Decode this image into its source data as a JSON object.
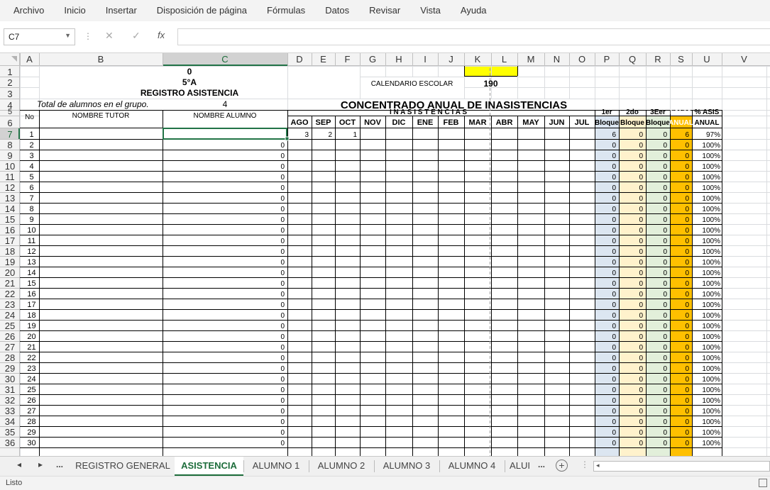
{
  "menu": [
    "Archivo",
    "Inicio",
    "Insertar",
    "Disposición de página",
    "Fórmulas",
    "Datos",
    "Revisar",
    "Vista",
    "Ayuda"
  ],
  "formula_bar": {
    "name_box": "C7",
    "cancel_icon": "✕",
    "enter_icon": "✓",
    "fx_label": "fx",
    "formula": ""
  },
  "columns": [
    "A",
    "B",
    "C",
    "D",
    "E",
    "F",
    "G",
    "H",
    "I",
    "J",
    "K",
    "L",
    "M",
    "N",
    "O",
    "P",
    "Q",
    "R",
    "S",
    "U",
    "V"
  ],
  "rows": [
    1,
    2,
    3,
    4,
    5,
    6,
    7,
    8,
    9,
    10,
    11,
    12,
    13,
    14,
    15,
    16,
    17,
    18,
    19,
    20,
    21,
    22,
    23,
    24,
    25,
    26,
    27,
    28,
    29,
    30,
    31,
    32,
    33,
    34,
    35,
    36
  ],
  "header_cells": {
    "c1": "0",
    "c2": "5°A",
    "c3": "REGISTRO ASISTENCIA",
    "total_label": "Total de alumnos en el grupo.",
    "total_value": "4",
    "calendario_label": "CALENDARIO ESCOLAR",
    "calendario_value": "190",
    "concentrado_title": "CONCENTRADO ANUAL DE INASISTENCIAS",
    "inasistencias_label": "I N A S I S T E N C I A S",
    "no_label": "No",
    "tutor_label": "NOMBRE TUTOR",
    "alumno_label": "NOMBRE ALUMNO",
    "months": [
      "AGO",
      "SEP",
      "OCT",
      "NOV",
      "DIC",
      "ENE",
      "FEB",
      "MAR",
      "ABR",
      "MAY",
      "JUN",
      "JUL"
    ],
    "bloque1_top": "1er",
    "bloque1_bottom": "Bloque",
    "bloque2_top": "2do",
    "bloque2_bottom": "Bloque",
    "bloque3_top": "3Eer",
    "bloque3_bottom": "Bloque",
    "falta_top": "FALTA",
    "falta_bottom": "ANUAL",
    "asis_top": "% ASIS",
    "asis_bottom": "ANUAL"
  },
  "students": [
    {
      "no": "1",
      "alumno": "",
      "ago": "3",
      "sep": "2",
      "oct": "1",
      "b1": "6",
      "b2": "0",
      "b3": "0",
      "falta": "6",
      "asis": "97%"
    },
    {
      "no": "2",
      "alumno": "0",
      "ago": "",
      "sep": "",
      "oct": "",
      "b1": "0",
      "b2": "0",
      "b3": "0",
      "falta": "0",
      "asis": "100%"
    },
    {
      "no": "3",
      "alumno": "0",
      "ago": "",
      "sep": "",
      "oct": "",
      "b1": "0",
      "b2": "0",
      "b3": "0",
      "falta": "0",
      "asis": "100%"
    },
    {
      "no": "4",
      "alumno": "0",
      "ago": "",
      "sep": "",
      "oct": "",
      "b1": "0",
      "b2": "0",
      "b3": "0",
      "falta": "0",
      "asis": "100%"
    },
    {
      "no": "5",
      "alumno": "0",
      "ago": "",
      "sep": "",
      "oct": "",
      "b1": "0",
      "b2": "0",
      "b3": "0",
      "falta": "0",
      "asis": "100%"
    },
    {
      "no": "6",
      "alumno": "0",
      "ago": "",
      "sep": "",
      "oct": "",
      "b1": "0",
      "b2": "0",
      "b3": "0",
      "falta": "0",
      "asis": "100%"
    },
    {
      "no": "7",
      "alumno": "0",
      "ago": "",
      "sep": "",
      "oct": "",
      "b1": "0",
      "b2": "0",
      "b3": "0",
      "falta": "0",
      "asis": "100%"
    },
    {
      "no": "8",
      "alumno": "0",
      "ago": "",
      "sep": "",
      "oct": "",
      "b1": "0",
      "b2": "0",
      "b3": "0",
      "falta": "0",
      "asis": "100%"
    },
    {
      "no": "9",
      "alumno": "0",
      "ago": "",
      "sep": "",
      "oct": "",
      "b1": "0",
      "b2": "0",
      "b3": "0",
      "falta": "0",
      "asis": "100%"
    },
    {
      "no": "10",
      "alumno": "0",
      "ago": "",
      "sep": "",
      "oct": "",
      "b1": "0",
      "b2": "0",
      "b3": "0",
      "falta": "0",
      "asis": "100%"
    },
    {
      "no": "11",
      "alumno": "0",
      "ago": "",
      "sep": "",
      "oct": "",
      "b1": "0",
      "b2": "0",
      "b3": "0",
      "falta": "0",
      "asis": "100%"
    },
    {
      "no": "12",
      "alumno": "0",
      "ago": "",
      "sep": "",
      "oct": "",
      "b1": "0",
      "b2": "0",
      "b3": "0",
      "falta": "0",
      "asis": "100%"
    },
    {
      "no": "13",
      "alumno": "0",
      "ago": "",
      "sep": "",
      "oct": "",
      "b1": "0",
      "b2": "0",
      "b3": "0",
      "falta": "0",
      "asis": "100%"
    },
    {
      "no": "14",
      "alumno": "0",
      "ago": "",
      "sep": "",
      "oct": "",
      "b1": "0",
      "b2": "0",
      "b3": "0",
      "falta": "0",
      "asis": "100%"
    },
    {
      "no": "15",
      "alumno": "0",
      "ago": "",
      "sep": "",
      "oct": "",
      "b1": "0",
      "b2": "0",
      "b3": "0",
      "falta": "0",
      "asis": "100%"
    },
    {
      "no": "16",
      "alumno": "0",
      "ago": "",
      "sep": "",
      "oct": "",
      "b1": "0",
      "b2": "0",
      "b3": "0",
      "falta": "0",
      "asis": "100%"
    },
    {
      "no": "17",
      "alumno": "0",
      "ago": "",
      "sep": "",
      "oct": "",
      "b1": "0",
      "b2": "0",
      "b3": "0",
      "falta": "0",
      "asis": "100%"
    },
    {
      "no": "18",
      "alumno": "0",
      "ago": "",
      "sep": "",
      "oct": "",
      "b1": "0",
      "b2": "0",
      "b3": "0",
      "falta": "0",
      "asis": "100%"
    },
    {
      "no": "19",
      "alumno": "0",
      "ago": "",
      "sep": "",
      "oct": "",
      "b1": "0",
      "b2": "0",
      "b3": "0",
      "falta": "0",
      "asis": "100%"
    },
    {
      "no": "20",
      "alumno": "0",
      "ago": "",
      "sep": "",
      "oct": "",
      "b1": "0",
      "b2": "0",
      "b3": "0",
      "falta": "0",
      "asis": "100%"
    },
    {
      "no": "21",
      "alumno": "0",
      "ago": "",
      "sep": "",
      "oct": "",
      "b1": "0",
      "b2": "0",
      "b3": "0",
      "falta": "0",
      "asis": "100%"
    },
    {
      "no": "22",
      "alumno": "0",
      "ago": "",
      "sep": "",
      "oct": "",
      "b1": "0",
      "b2": "0",
      "b3": "0",
      "falta": "0",
      "asis": "100%"
    },
    {
      "no": "23",
      "alumno": "0",
      "ago": "",
      "sep": "",
      "oct": "",
      "b1": "0",
      "b2": "0",
      "b3": "0",
      "falta": "0",
      "asis": "100%"
    },
    {
      "no": "24",
      "alumno": "0",
      "ago": "",
      "sep": "",
      "oct": "",
      "b1": "0",
      "b2": "0",
      "b3": "0",
      "falta": "0",
      "asis": "100%"
    },
    {
      "no": "25",
      "alumno": "0",
      "ago": "",
      "sep": "",
      "oct": "",
      "b1": "0",
      "b2": "0",
      "b3": "0",
      "falta": "0",
      "asis": "100%"
    },
    {
      "no": "26",
      "alumno": "0",
      "ago": "",
      "sep": "",
      "oct": "",
      "b1": "0",
      "b2": "0",
      "b3": "0",
      "falta": "0",
      "asis": "100%"
    },
    {
      "no": "27",
      "alumno": "0",
      "ago": "",
      "sep": "",
      "oct": "",
      "b1": "0",
      "b2": "0",
      "b3": "0",
      "falta": "0",
      "asis": "100%"
    },
    {
      "no": "28",
      "alumno": "0",
      "ago": "",
      "sep": "",
      "oct": "",
      "b1": "0",
      "b2": "0",
      "b3": "0",
      "falta": "0",
      "asis": "100%"
    },
    {
      "no": "29",
      "alumno": "0",
      "ago": "",
      "sep": "",
      "oct": "",
      "b1": "0",
      "b2": "0",
      "b3": "0",
      "falta": "0",
      "asis": "100%"
    },
    {
      "no": "30",
      "alumno": "0",
      "ago": "",
      "sep": "",
      "oct": "",
      "b1": "0",
      "b2": "0",
      "b3": "0",
      "falta": "0",
      "asis": "100%"
    }
  ],
  "sheet_tabs": [
    {
      "label": "REGISTRO GENERAL",
      "active": false
    },
    {
      "label": "ASISTENCIA",
      "active": true
    },
    {
      "label": "ALUMNO 1",
      "active": false
    },
    {
      "label": "ALUMNO 2",
      "active": false
    },
    {
      "label": "ALUMNO 3",
      "active": false
    },
    {
      "label": "ALUMNO 4",
      "active": false
    },
    {
      "label": "ALUI",
      "active": false
    }
  ],
  "tab_nav": {
    "prev": "◂",
    "next": "▸",
    "more_left": "...",
    "more_right": "...",
    "add": "+"
  },
  "status": "Listo",
  "colors": {
    "bloque1": "#dce6f1",
    "bloque2": "#fff2cc",
    "bloque3": "#e2efda",
    "falta": "#ffc000",
    "calendario": "#ffff00",
    "selection": "#217346"
  }
}
